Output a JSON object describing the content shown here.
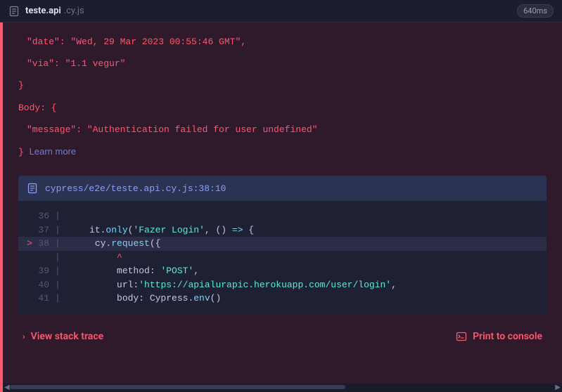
{
  "header": {
    "title": "teste.api",
    "ext": ".cy.js",
    "duration": "640ms"
  },
  "error": {
    "date_line": "\"date\": \"Wed, 29 Mar 2023 00:55:46 GMT\",",
    "via_line": "\"via\": \"1.1 vegur\"",
    "close_brace": "}",
    "body_open": "Body: {",
    "message_line": "\"message\": \"Authentication failed for user undefined\"",
    "body_close": "}",
    "learn_more": "Learn more"
  },
  "codeframe": {
    "path": "cypress/e2e/teste.api.cy.js:38:10",
    "lines": [
      {
        "num": "36",
        "marker": "",
        "hl": false,
        "html": ""
      },
      {
        "num": "37",
        "marker": "",
        "hl": false,
        "html": "    it.<span class='tok-method'>only</span>(<span class='tok-str'>'Fazer Login'</span>, () <span class='tok-kw'>=></span> {"
      },
      {
        "num": "38",
        "marker": ">",
        "hl": true,
        "html": "     cy.<span class='tok-method'>request</span>({"
      },
      {
        "num": "",
        "marker": "",
        "hl": false,
        "caret": true,
        "html": "         ^"
      },
      {
        "num": "39",
        "marker": "",
        "hl": false,
        "html": "         method: <span class='tok-str'>'POST'</span>,"
      },
      {
        "num": "40",
        "marker": "",
        "hl": false,
        "html": "         url:<span class='tok-str'>'https://apialurapic.herokuapp.com/user/login'</span>,"
      },
      {
        "num": "41",
        "marker": "",
        "hl": false,
        "html": "         body: Cypress.<span class='tok-method'>env</span>()"
      }
    ]
  },
  "footer": {
    "stack_trace": "View stack trace",
    "print": "Print to console"
  }
}
